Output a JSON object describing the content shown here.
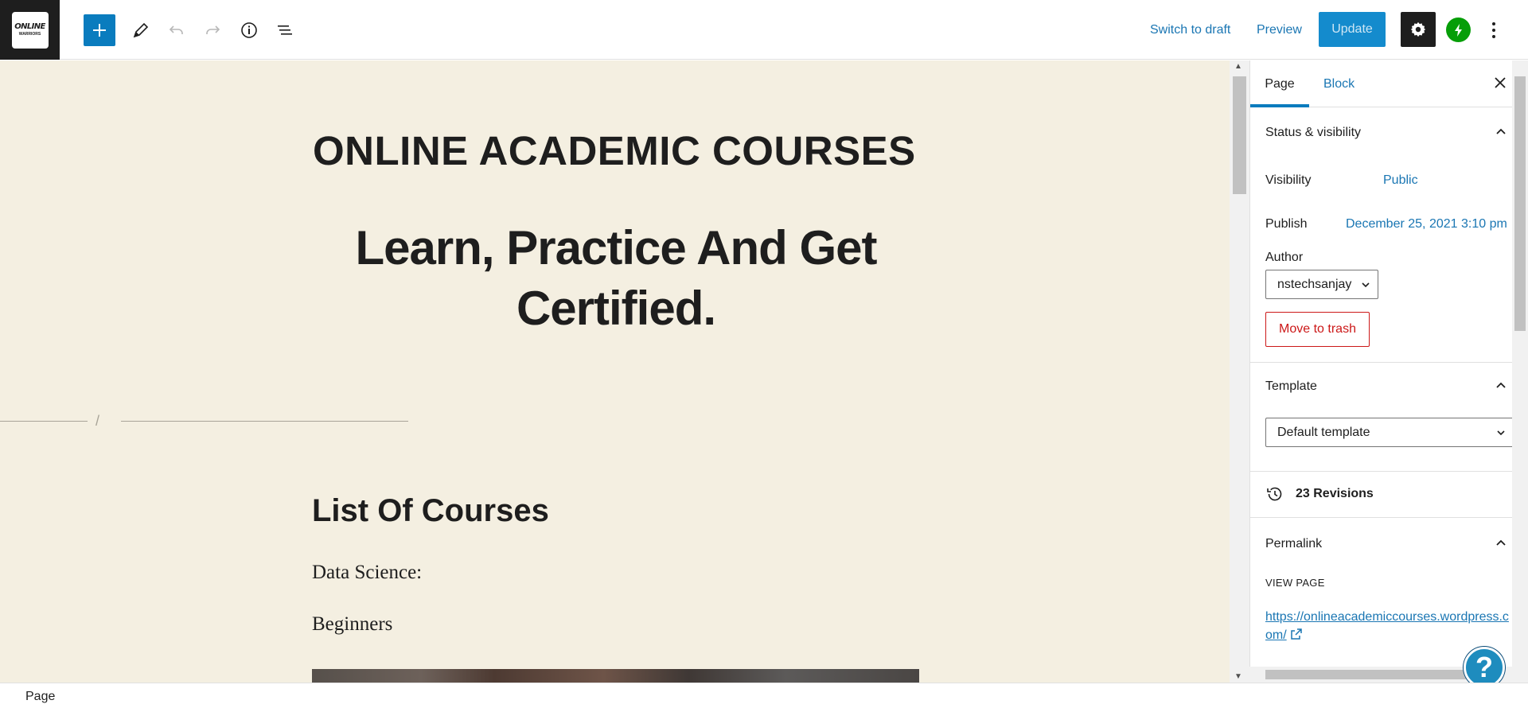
{
  "header": {
    "logo": {
      "line1": "ONLINE",
      "line2": "WARRIORS"
    },
    "switch_to_draft": "Switch to draft",
    "preview": "Preview",
    "update": "Update",
    "icons": {
      "inserter": "plus-icon",
      "tools": "pencil-icon",
      "undo": "undo-icon",
      "redo": "redo-icon",
      "details": "info-icon",
      "outline": "list-view-icon",
      "settings": "gear-icon",
      "jetpack": "bolt-icon",
      "more": "vertical-ellipsis-icon"
    },
    "colors": {
      "accent": "#0a7cbe",
      "link": "#1a76b3",
      "jetpack": "#069e08"
    }
  },
  "canvas": {
    "site_title": "ONLINE ACADEMIC COURSES",
    "heading_line1": "Learn, Practice And Get",
    "heading_line2": "Certified.",
    "separator_glyph": "/",
    "courses_heading": "List Of Courses",
    "para1": "Data Science:",
    "para2": "Beginners",
    "background": "#f4efe1"
  },
  "sidebar": {
    "tabs": [
      {
        "label": "Page",
        "active": true
      },
      {
        "label": "Block",
        "active": false
      }
    ],
    "status": {
      "title": "Status & visibility",
      "visibility_label": "Visibility",
      "visibility_value": "Public",
      "publish_label": "Publish",
      "publish_value": "December 25, 2021 3:10 pm",
      "author_label": "Author",
      "author_value": "nstechsanjay",
      "trash": "Move to trash"
    },
    "template": {
      "title": "Template",
      "value": "Default template"
    },
    "revisions": "23 Revisions",
    "permalink": {
      "title": "Permalink",
      "view_page": "VIEW PAGE",
      "url": "https://onlineacademiccourses.wordpress.com/"
    },
    "help": "?"
  },
  "footer": {
    "breadcrumb": "Page"
  }
}
